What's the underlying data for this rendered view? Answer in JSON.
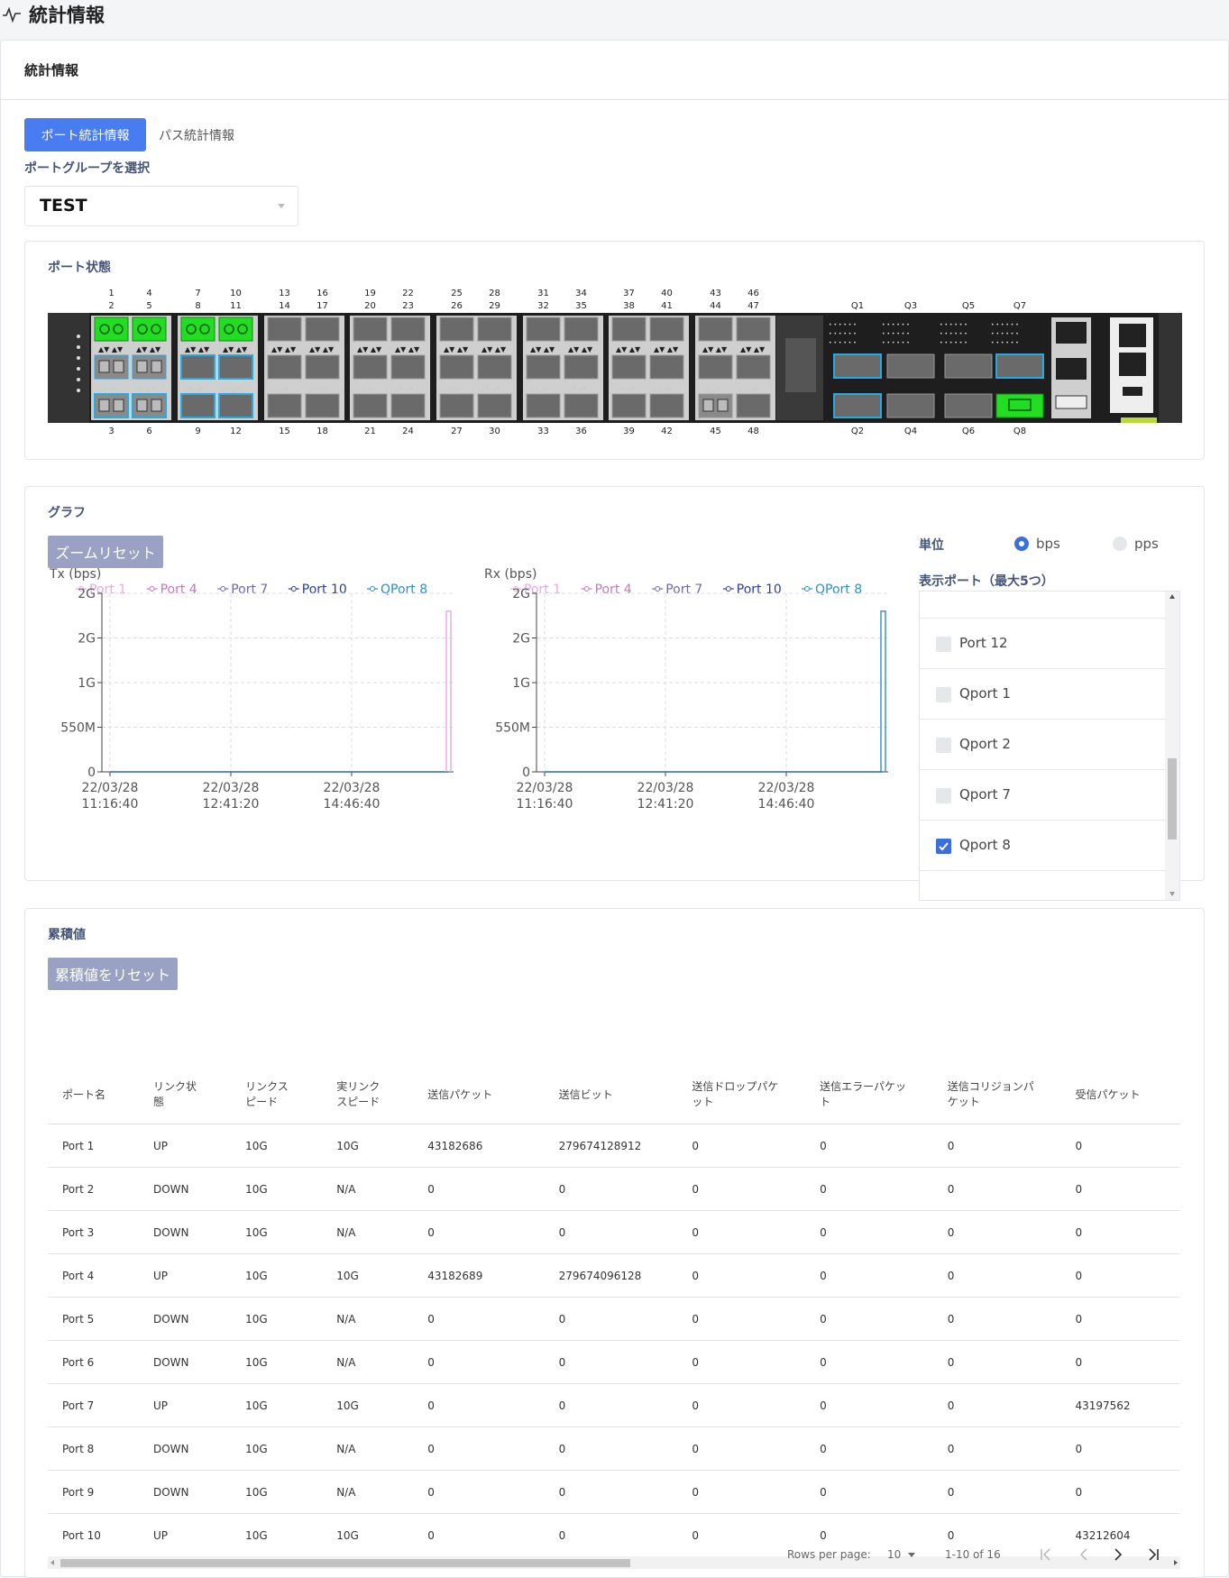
{
  "page_title": "統計情報",
  "card_title": "統計情報",
  "tabs": [
    {
      "label": "ポート統計情報",
      "active": true
    },
    {
      "label": "パス統計情報",
      "active": false
    }
  ],
  "port_group": {
    "label": "ポートグループを選択",
    "value": "TEST"
  },
  "port_status": {
    "title": "ポート状態",
    "top_numbers": [
      [
        "1",
        "2"
      ],
      [
        "4",
        "5"
      ],
      [
        "7",
        "8"
      ],
      [
        "10",
        "11"
      ],
      [
        "13",
        "14"
      ],
      [
        "16",
        "17"
      ],
      [
        "19",
        "20"
      ],
      [
        "22",
        "23"
      ],
      [
        "25",
        "26"
      ],
      [
        "28",
        "29"
      ],
      [
        "31",
        "32"
      ],
      [
        "34",
        "35"
      ],
      [
        "37",
        "38"
      ],
      [
        "40",
        "41"
      ],
      [
        "43",
        "44"
      ],
      [
        "46",
        "47"
      ]
    ],
    "bottom_numbers": [
      "3",
      "6",
      "9",
      "12",
      "15",
      "18",
      "21",
      "24",
      "27",
      "30",
      "33",
      "36",
      "39",
      "42",
      "45",
      "48"
    ],
    "qsfp_top": [
      "Q1",
      "Q3",
      "Q5",
      "Q7"
    ],
    "qsfp_bottom": [
      "Q2",
      "Q4",
      "Q6",
      "Q8"
    ],
    "colors": {
      "up": "#22dd22",
      "selected": "#2aa8e0",
      "empty": "#6a6a6a",
      "chassis": "#2a2a2a"
    }
  },
  "graph": {
    "title": "グラフ",
    "zoom_reset": "ズームリセット",
    "unit_label": "単位",
    "units": [
      {
        "label": "bps",
        "checked": true
      },
      {
        "label": "pps",
        "checked": false
      }
    ],
    "display_ports_label": "表示ポート（最大5つ）",
    "port_list": [
      {
        "label": "Port 12",
        "checked": false
      },
      {
        "label": "Qport 1",
        "checked": false
      },
      {
        "label": "Qport 2",
        "checked": false
      },
      {
        "label": "Qport 7",
        "checked": false
      },
      {
        "label": "Qport 8",
        "checked": true
      }
    ]
  },
  "chart_data": [
    {
      "type": "line",
      "title": "Tx (bps)",
      "series": [
        {
          "name": "Port 1",
          "color": "#e9a6e6"
        },
        {
          "name": "Port 4",
          "color": "#c27bbd"
        },
        {
          "name": "Port 7",
          "color": "#6f6aa8"
        },
        {
          "name": "Port 10",
          "color": "#2d3f8f"
        },
        {
          "name": "QPort 8",
          "color": "#2a8ec9"
        }
      ],
      "yticks": [
        "2G",
        "2G",
        "1G",
        "550M",
        "0"
      ],
      "xticks": [
        [
          "22/03/28",
          "11:16:40"
        ],
        [
          "22/03/28",
          "12:41:20"
        ],
        [
          "22/03/28",
          "14:46:40"
        ]
      ],
      "spike_series": "Port 1",
      "spike_value_fraction": 0.9
    },
    {
      "type": "line",
      "title": "Rx (bps)",
      "series": [
        {
          "name": "Port 1",
          "color": "#e9a6e6"
        },
        {
          "name": "Port 4",
          "color": "#c27bbd"
        },
        {
          "name": "Port 7",
          "color": "#6f6aa8"
        },
        {
          "name": "Port 10",
          "color": "#2d3f8f"
        },
        {
          "name": "QPort 8",
          "color": "#2a8ec9"
        }
      ],
      "yticks": [
        "2G",
        "2G",
        "1G",
        "550M",
        "0"
      ],
      "xticks": [
        [
          "22/03/28",
          "11:16:40"
        ],
        [
          "22/03/28",
          "12:41:20"
        ],
        [
          "22/03/28",
          "14:46:40"
        ]
      ],
      "spike_series": "QPort 8",
      "spike_value_fraction": 0.9
    }
  ],
  "cumulative": {
    "title": "累積値",
    "reset_button": "累積値をリセット",
    "columns": [
      "ポート名",
      "リンク状態",
      "リンクスピード",
      "実リンクスピード",
      "送信パケット",
      "送信ビット",
      "送信ドロップパケット",
      "送信エラーパケット",
      "送信コリジョンパケット",
      "受信パケット"
    ],
    "column_lines": [
      [
        "ポート名"
      ],
      [
        "リンク状",
        "態"
      ],
      [
        "リンクス",
        "ピード"
      ],
      [
        "実リンク",
        "スピード"
      ],
      [
        "送信パケット"
      ],
      [
        "送信ビット"
      ],
      [
        "送信ドロップパケ",
        "ット"
      ],
      [
        "送信エラーパケッ",
        "ト"
      ],
      [
        "送信コリジョンパ",
        "ケット"
      ],
      [
        "受信パケット"
      ]
    ],
    "rows": [
      [
        "Port 1",
        "UP",
        "10G",
        "10G",
        "43182686",
        "279674128912",
        "0",
        "0",
        "0",
        "0"
      ],
      [
        "Port 2",
        "DOWN",
        "10G",
        "N/A",
        "0",
        "0",
        "0",
        "0",
        "0",
        "0"
      ],
      [
        "Port 3",
        "DOWN",
        "10G",
        "N/A",
        "0",
        "0",
        "0",
        "0",
        "0",
        "0"
      ],
      [
        "Port 4",
        "UP",
        "10G",
        "10G",
        "43182689",
        "279674096128",
        "0",
        "0",
        "0",
        "0"
      ],
      [
        "Port 5",
        "DOWN",
        "10G",
        "N/A",
        "0",
        "0",
        "0",
        "0",
        "0",
        "0"
      ],
      [
        "Port 6",
        "DOWN",
        "10G",
        "N/A",
        "0",
        "0",
        "0",
        "0",
        "0",
        "0"
      ],
      [
        "Port 7",
        "UP",
        "10G",
        "10G",
        "0",
        "0",
        "0",
        "0",
        "0",
        "43197562"
      ],
      [
        "Port 8",
        "DOWN",
        "10G",
        "N/A",
        "0",
        "0",
        "0",
        "0",
        "0",
        "0"
      ],
      [
        "Port 9",
        "DOWN",
        "10G",
        "N/A",
        "0",
        "0",
        "0",
        "0",
        "0",
        "0"
      ],
      [
        "Port 10",
        "UP",
        "10G",
        "10G",
        "0",
        "0",
        "0",
        "0",
        "0",
        "43212604"
      ]
    ],
    "pager": {
      "rows_per_page_label": "Rows per page:",
      "rows_per_page": "10",
      "range": "1-10 of 16"
    }
  }
}
